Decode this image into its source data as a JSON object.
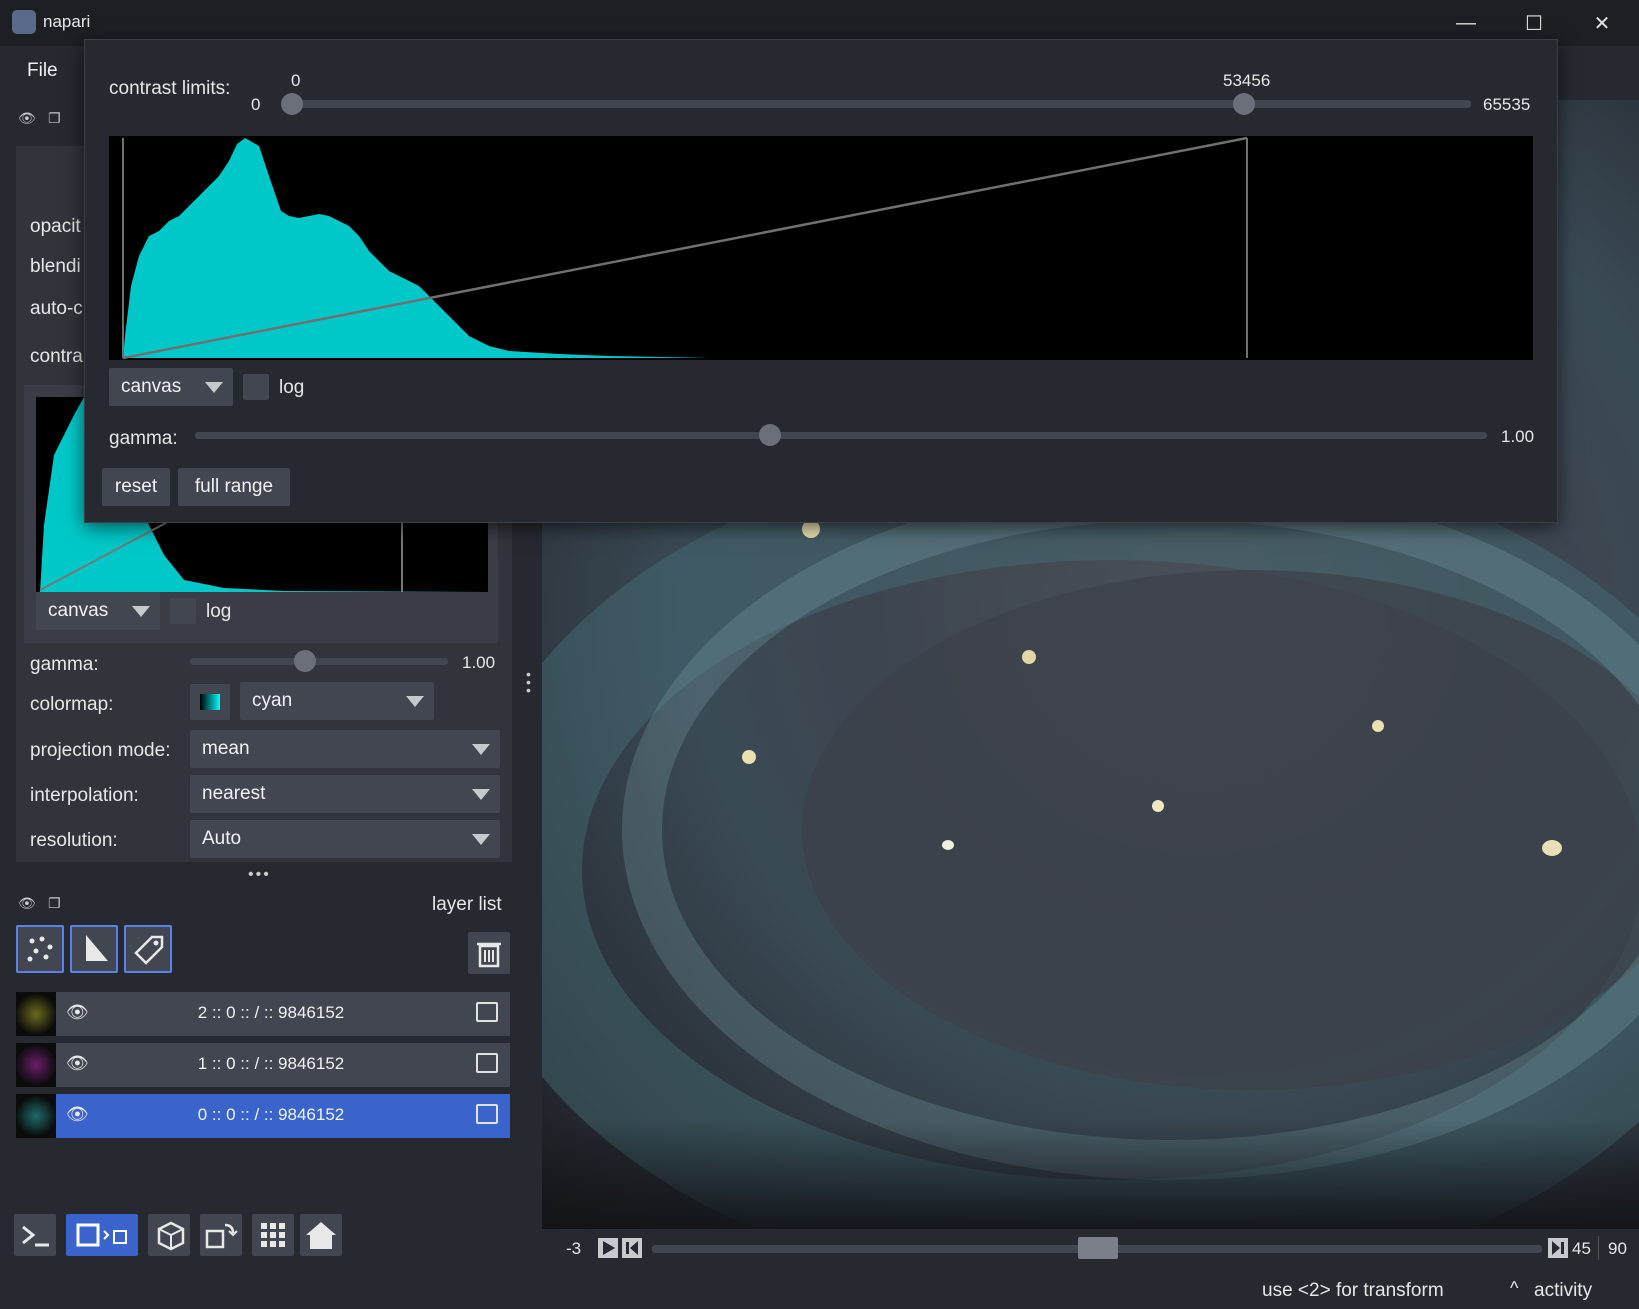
{
  "window": {
    "title": "napari",
    "minimize": "—",
    "maximize": "☐",
    "close": "✕"
  },
  "menu": {
    "file": "File"
  },
  "layer_controls": {
    "opacity_label": "opacit",
    "blending_label": "blendi",
    "auto_contrast_label": "auto-c",
    "contrast_label": "contra",
    "hist_mode": "canvas",
    "log_label": "log",
    "gamma_label": "gamma:",
    "gamma_value": "1.00",
    "colormap_label": "colormap:",
    "colormap_value": "cyan",
    "projection_label": "projection mode:",
    "projection_value": "mean",
    "interpolation_label": "interpolation:",
    "interpolation_value": "nearest",
    "resolution_label": "resolution:",
    "resolution_value": "Auto",
    "more": "•••"
  },
  "layer_list": {
    "title": "layer list",
    "layers": [
      {
        "name": "2 :: 0 :: / :: 9846152",
        "selected": false,
        "thumb_color": "#6b6a1e"
      },
      {
        "name": "1 :: 0 :: / :: 9846152",
        "selected": false,
        "thumb_color": "#6a1e6a"
      },
      {
        "name": "0 :: 0 :: / :: 9846152",
        "selected": true,
        "thumb_color": "#1e6a6a"
      }
    ]
  },
  "popup": {
    "contrast_label": "contrast limits:",
    "min_value": "0",
    "max_value": "53456",
    "range_min": "0",
    "range_max": "65535",
    "hist_mode": "canvas",
    "log_label": "log",
    "gamma_label": "gamma:",
    "gamma_value": "1.00",
    "reset_label": "reset",
    "full_range_label": "full range"
  },
  "dims": {
    "left_value": "-3",
    "frame_value": "45",
    "total_value": "90"
  },
  "status": {
    "hint": "use <2> for transform",
    "activity": "activity"
  },
  "colors": {
    "accent": "#3a64cc",
    "histogram": "#00c8c8",
    "background": "#262930",
    "panel": "#31343b"
  }
}
